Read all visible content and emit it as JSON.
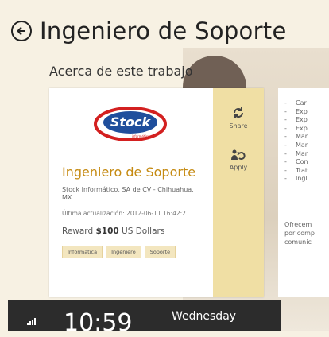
{
  "header": {
    "title": "Ingeniero de Soporte"
  },
  "section_title": "Acerca de este trabajo",
  "job": {
    "logo_text": "Stock",
    "logo_subtext": "informático",
    "title": "Ingeniero de Soporte",
    "company": "Stock Informático, SA de CV - Chihuahua, MX",
    "updated": "Última actualización: 2012-06-11 16:42:21",
    "reward_prefix": "Reward",
    "reward_amount": "$100",
    "reward_suffix": "US Dollars",
    "tags": [
      "Informatica",
      "Ingeniero",
      "Soporte"
    ]
  },
  "actions": {
    "share_label": "Share",
    "apply_label": "Apply"
  },
  "details": {
    "bullets": [
      "Car",
      "Exp",
      "Exp",
      "Exp",
      "Mar",
      "Mar",
      "Mar",
      "Con",
      "Trat",
      "Ingl"
    ],
    "paragraph_lines": [
      "Ofrecem",
      "por comp",
      "comunic"
    ]
  },
  "status": {
    "time": "10:59",
    "day": "Wednesday"
  },
  "colors": {
    "accent": "#c58a11",
    "action_panel": "#f0dfa4",
    "tag_bg": "#f3e6bf",
    "background": "#f7f1e3"
  }
}
